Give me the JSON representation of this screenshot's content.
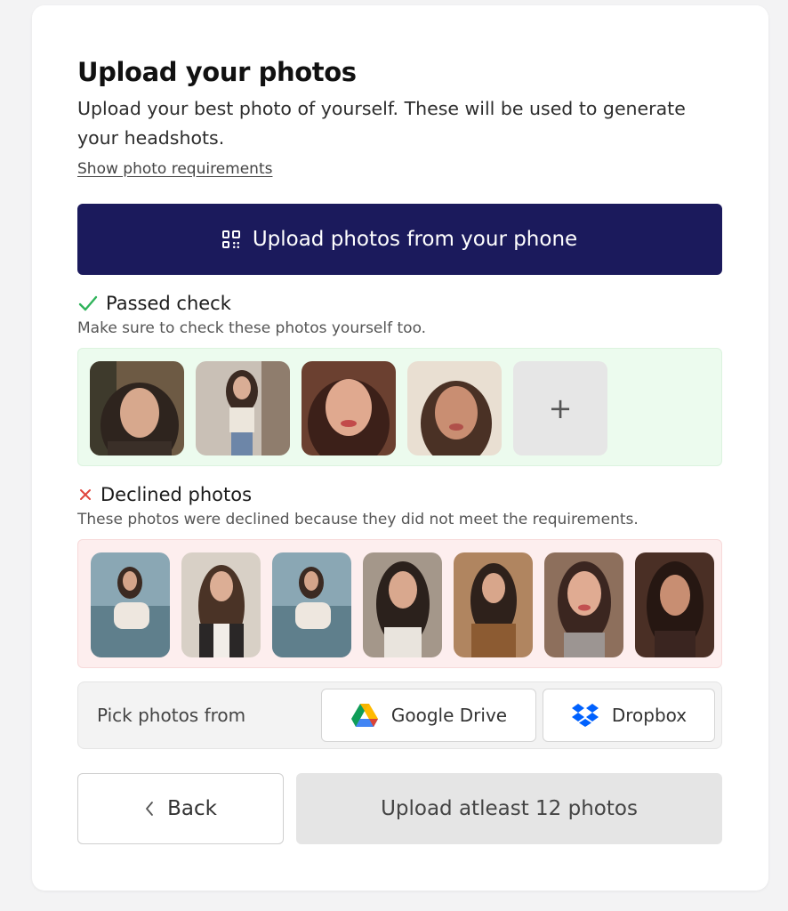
{
  "header": {
    "title": "Upload your photos",
    "subtitle": "Upload your best photo of yourself. These will be used to generate your headshots.",
    "requirements_link": "Show photo requirements"
  },
  "phone_upload": {
    "label": "Upload photos from your phone",
    "icon": "qr-code-icon"
  },
  "passed": {
    "title": "Passed check",
    "subtitle": "Make sure to check these photos yourself too.",
    "icon": "checkmark-icon",
    "add_label": "+"
  },
  "declined": {
    "title": "Declined photos",
    "subtitle": "These photos were declined because they did not meet the requirements.",
    "icon": "cross-icon"
  },
  "pick": {
    "label": "Pick photos from",
    "google_drive": "Google Drive",
    "dropbox": "Dropbox"
  },
  "footer": {
    "back_label": "Back",
    "upload_label": "Upload atleast 12 photos"
  },
  "colors": {
    "primary": "#1b1a5c",
    "passed_bg": "#ecfbee",
    "declined_bg": "#fdeeee",
    "check": "#2fb35a",
    "cross": "#e0453d"
  }
}
